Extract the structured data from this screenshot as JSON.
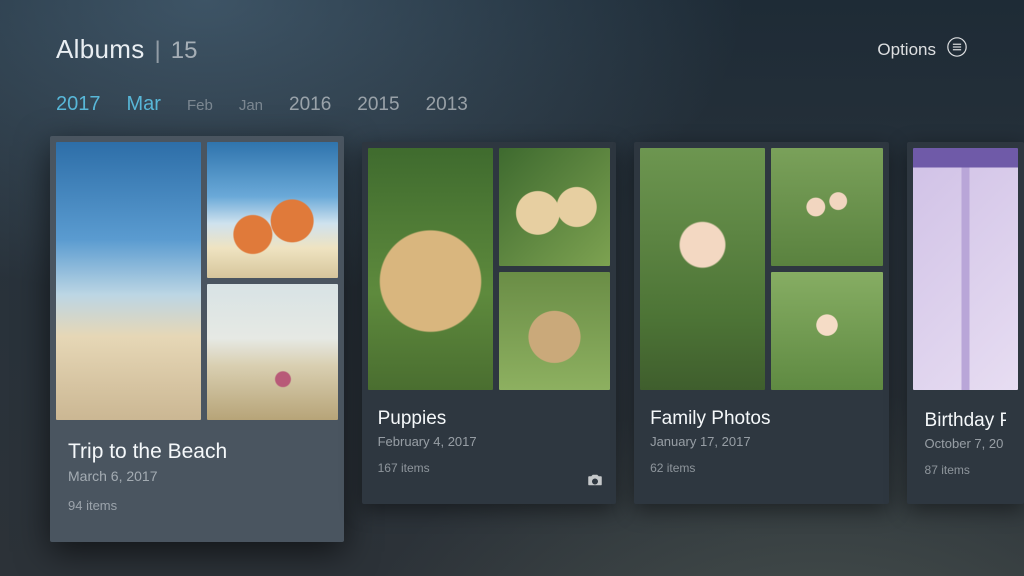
{
  "header": {
    "title": "Albums",
    "separator": "|",
    "count": "15",
    "options_label": "Options"
  },
  "filters": [
    {
      "label": "2017",
      "kind": "year",
      "active": true
    },
    {
      "label": "Mar",
      "kind": "month",
      "active": true
    },
    {
      "label": "Feb",
      "kind": "month",
      "active": false
    },
    {
      "label": "Jan",
      "kind": "month",
      "active": false
    },
    {
      "label": "2016",
      "kind": "year",
      "active": false
    },
    {
      "label": "2015",
      "kind": "year",
      "active": false
    },
    {
      "label": "2013",
      "kind": "year",
      "active": false
    }
  ],
  "albums": [
    {
      "title": "Trip to the Beach",
      "date": "March 6, 2017",
      "items_label": "94 items",
      "focused": true,
      "has_camera_badge": false,
      "thumbs": [
        "beach-sky",
        "beach-umbrella",
        "beach-girl"
      ]
    },
    {
      "title": "Puppies",
      "date": "February 4, 2017",
      "items_label": "167 items",
      "focused": false,
      "has_camera_badge": true,
      "thumbs": [
        "puppy-lab",
        "puppy-pair",
        "puppy-pug"
      ]
    },
    {
      "title": "Family Photos",
      "date": "January 17, 2017",
      "items_label": "62 items",
      "focused": false,
      "has_camera_badge": false,
      "thumbs": [
        "fam-boy",
        "fam-group",
        "fam-girl"
      ]
    },
    {
      "title": "Birthday P",
      "date": "October 7, 20",
      "items_label": "87 items",
      "focused": false,
      "has_camera_badge": false,
      "partial": true,
      "thumbs": [
        "gift"
      ]
    }
  ]
}
